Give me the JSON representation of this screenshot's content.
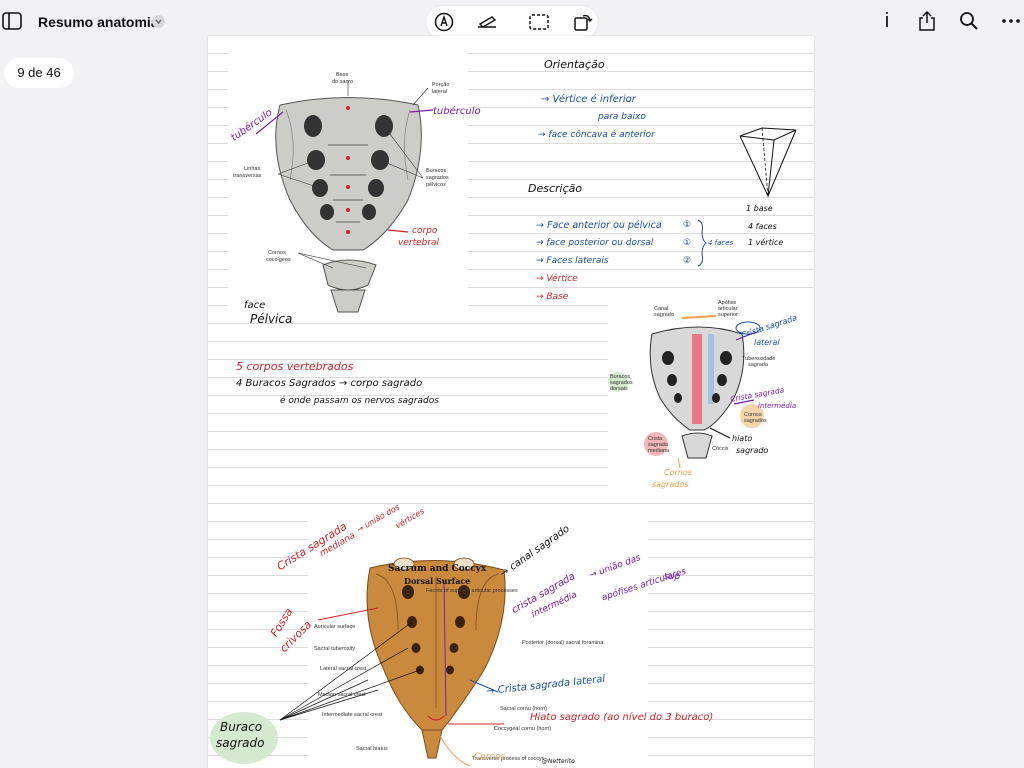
{
  "app": {
    "doc_title": "Resumo anatomia",
    "page_indicator": "9 de 46"
  },
  "colors": {
    "background": "#f2f2f4",
    "ink_blue": "#1c4fa8",
    "ink_red": "#d0242a",
    "ink_purple": "#7a1fa8",
    "ink_black": "#111111",
    "bone": "#c98a3d"
  },
  "toolbar": {
    "icons": [
      "pen-tool-icon",
      "highlighter-icon",
      "lasso-select-icon",
      "rotate-icon"
    ]
  },
  "right_actions": {
    "info": "i",
    "icons": [
      "share-icon",
      "search-icon",
      "more-icon"
    ]
  },
  "fig1": {
    "labels": [
      "Base\ndo sacro",
      "Porção\nlateral",
      "Linhas\ntransversas",
      "Buracos\nsagrados\npélvicos",
      "Cornos\ncoccígeos"
    ],
    "l_base": "Base",
    "l_base2": "do sacro",
    "l_porcao": "Porção",
    "l_lateral": "lateral",
    "l_linhas": "Linhas",
    "l_transversas": "transversas",
    "l_buracos": "Buracos",
    "l_sagrados": "sagrados",
    "l_pelvicos": "pélvicos",
    "l_cornos": "Cornos",
    "l_coccigeos": "coccígeos",
    "hw_tuberculo_left": "tubérculo",
    "hw_tuberculo_right": "tubérculo",
    "hw_corpo": "corpo",
    "hw_vertebral": "vertebral",
    "hw_face": "face",
    "hw_pelvica": "Pélvica"
  },
  "notes": {
    "orientacao": "Orientação",
    "vertice": "→ Vértice é inferior",
    "para_baixo": "para baixo",
    "face_concava": "→ face côncava é anterior",
    "descricao": "Descrição",
    "face_anterior": "→ Face anterior ou pélvica",
    "face_posterior": "→ face posterior ou dorsal",
    "faces_laterais": "→ Faces laterais",
    "vertice_item": "→ Vértice",
    "base_item": "→ Base",
    "n1": "①",
    "n1b": "①",
    "n2": "②",
    "four_faces": "4 faces",
    "pyr_base": "1 base",
    "pyr_faces": "4 faces",
    "pyr_vertice": "1 vértice",
    "corpos": "5 corpos vertebrados",
    "buracos": "4 Buracos Sagrados → corpo sagrado",
    "onde": "é onde passam os nervos sagrados"
  },
  "fig2": {
    "l_canal": "Canal",
    "l_sagrado": "sagrado",
    "l_apofise": "Apófise",
    "l_articular": "articular",
    "l_superior": "superior",
    "l_tuberosidade": "Tuberosidade",
    "l_tub_sagrada": "sagrada",
    "l_buracos": "Buracos",
    "l_buracos2": "sagrados",
    "l_buracos3": "dorsais",
    "l_cornos": "Cornos",
    "l_cornos2": "sagrados",
    "l_crista": "Crista",
    "l_crista2": "sagrada",
    "l_crista3": "mediana",
    "l_coccix": "Cóccix",
    "hw_crista_lateral1": "Crista sagrada",
    "hw_crista_lateral2": "lateral",
    "hw_crista_int1": "Crista sagrada",
    "hw_crista_int2": "intermédia",
    "hw_hiato1": "hiato",
    "hw_hiato2": "sagrado",
    "hw_cornos1": "Cornos",
    "hw_cornos2": "sagrados"
  },
  "fig3": {
    "title": "Sacrum and Coccyx",
    "subtitle": "Dorsal Surface",
    "labels": [
      "Facets of superior articular processes",
      "Auricular surface",
      "Sacral tuberosity",
      "Lateral sacral crest",
      "Median sacral crest",
      "Intermediate sacral crest",
      "Sacral hiatus",
      "Posterior (dorsal) sacral foramina",
      "Sacral cornu (horn)",
      "Coccygeal cornu (horn)",
      "Transverse process of coccyx"
    ],
    "signature": "@Netterito",
    "hw_crista_mediana1": "Crista sagrada",
    "hw_crista_mediana2": "mediana",
    "hw_uniao_vertices1": "→ união dos",
    "hw_uniao_vertices2": "vértices",
    "hw_canal": "→ canal sagrado",
    "hw_fossa1": "Fossa",
    "hw_fossa2": "crivosa",
    "hw_crista_int1": "crista sagrada",
    "hw_crista_int2": "intermédia",
    "hw_uniao_apof1": "→ união das",
    "hw_uniao_apof2": "apófises articulares",
    "hw_uniao_apof3": "sup",
    "hw_crista_lat": "→ Crista sagrada lateral",
    "hw_hiato": "Hiato sagrado (ao nível do 3 buraco)",
    "hw_buraco1": "Buraco",
    "hw_buraco2": "sagrado",
    "hw_cornos": "Cornos"
  }
}
